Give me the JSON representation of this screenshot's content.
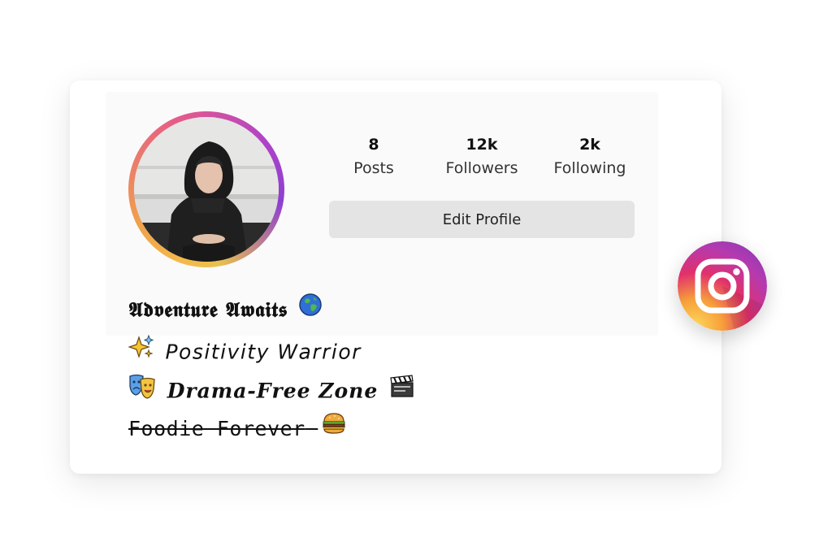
{
  "profile": {
    "stats": [
      {
        "value": "8",
        "label": "Posts"
      },
      {
        "value": "12k",
        "label": "Followers"
      },
      {
        "value": "2k",
        "label": "Following"
      }
    ],
    "edit_button_label": "Edit Profile",
    "avatar_icon": "profile-photo-hooded-person"
  },
  "bio": {
    "line1": {
      "text": "𝕬𝖉𝖛𝖊𝖓𝖙𝖚𝖗𝖊 𝕬𝖜𝖆𝖎𝖙𝖘",
      "emoji_after": "globe-icon"
    },
    "line2": {
      "text": "𝘗𝘰𝘴𝘪𝘵𝘪𝘷𝘪𝘵𝘺 𝘞𝘢𝘳𝘳𝘪𝘰𝘳",
      "emoji_before": "sparkles-icon"
    },
    "line3": {
      "text": "𝑫𝒓𝒂𝒎𝒂-𝑭𝒓𝒆𝒆 𝒁𝒐𝒏𝒆",
      "emoji_before": "theater-masks-icon",
      "emoji_after": "clapper-board-icon"
    },
    "line4": {
      "text": "Foodie Forever",
      "emoji_after": "burger-icon"
    }
  },
  "badge": {
    "icon": "instagram-logo-icon"
  },
  "colors": {
    "ring_start": "#f5b94a",
    "ring_mid": "#e55a8a",
    "ring_end": "#8d3fd1",
    "button_bg": "#e4e4e4",
    "badge_orange": "#f7a03a",
    "badge_pink": "#e1306c",
    "badge_purple": "#833ab4"
  }
}
